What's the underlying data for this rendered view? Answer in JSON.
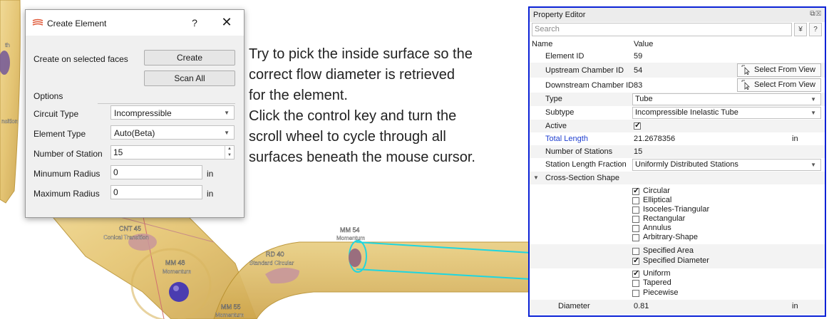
{
  "viewport": {
    "labels": [
      {
        "name": "CNT 45",
        "sub": "Conical Transition"
      },
      {
        "name": "MM 48",
        "sub": "Momentum"
      },
      {
        "name": "RD 40",
        "sub": "Standard Circular"
      },
      {
        "name": "MM 54",
        "sub": "Momentum"
      },
      {
        "name": "MM 55",
        "sub": "Momentum"
      }
    ],
    "partial_labels": [
      "th",
      "nsition"
    ],
    "colors": {
      "pipe": "#e6c572",
      "pipe_edge": "#b8902e",
      "node": "#4a3cb0",
      "highlight": "#1ed6e0",
      "disk": "#c8979b"
    }
  },
  "dialog": {
    "title": "Create Element",
    "title_icon": "layers-icon",
    "help": "?",
    "close": "✕",
    "create_on_faces_label": "Create on selected faces",
    "create_button": "Create",
    "scan_all_button": "Scan All",
    "options_label": "Options",
    "circuit_type_label": "Circuit Type",
    "circuit_type_value": "Incompressible",
    "element_type_label": "Element Type",
    "element_type_value": "Auto(Beta)",
    "num_station_label": "Number of Station",
    "num_station_value": "15",
    "min_radius_label": "Minumum Radius",
    "min_radius_value": "0",
    "min_radius_unit": "in",
    "max_radius_label": "Maximum Radius",
    "max_radius_value": "0",
    "max_radius_unit": "in"
  },
  "instructions": {
    "para1_lines": [
      "Try to pick the inside surface so the",
      "correct flow diameter is retrieved",
      "for the element."
    ],
    "para2_lines": [
      "Click the control key and turn the",
      "scroll wheel to cycle through all",
      "surfaces beneath the mouse cursor."
    ]
  },
  "property_editor": {
    "title": "Property Editor",
    "search_placeholder": "Search",
    "filter_btn": "¥",
    "help_btn": "?",
    "col_name": "Name",
    "col_value": "Value",
    "element_id_label": "Element ID",
    "element_id_value": "59",
    "upstream_label": "Upstream Chamber ID",
    "upstream_value": "54",
    "downstream_label": "Downstream Chamber ID",
    "downstream_value": "83",
    "select_from_view": "Select From View",
    "type_label": "Type",
    "type_value": "Tube",
    "subtype_label": "Subtype",
    "subtype_value": "Incompressible Inelastic Tube",
    "active_label": "Active",
    "total_length_label": "Total Length",
    "total_length_value": "21.2678356",
    "total_length_unit": "in",
    "num_stations_label": "Number of Stations",
    "num_stations_value": "15",
    "station_fraction_label": "Station Length Fraction",
    "station_fraction_value": "Uniformly Distributed Stations",
    "cross_section_label": "Cross-Section Shape",
    "shapes": [
      {
        "label": "Circular",
        "checked": true
      },
      {
        "label": "Elliptical",
        "checked": false
      },
      {
        "label": "Isoceles-Triangular",
        "checked": false
      },
      {
        "label": "Rectangular",
        "checked": false
      },
      {
        "label": "Annulus",
        "checked": false
      },
      {
        "label": "Arbitrary-Shape",
        "checked": false
      }
    ],
    "size_specs": [
      {
        "label": "Specified Area",
        "checked": false
      },
      {
        "label": "Specified Diameter",
        "checked": true
      }
    ],
    "profiles": [
      {
        "label": "Uniform",
        "checked": true
      },
      {
        "label": "Tapered",
        "checked": false
      },
      {
        "label": "Piecewise",
        "checked": false
      }
    ],
    "diameter_label": "Diameter",
    "diameter_value": "0.81",
    "diameter_unit": "in",
    "accent_color": "#0b22d6",
    "link_color": "#1f3fd0"
  }
}
